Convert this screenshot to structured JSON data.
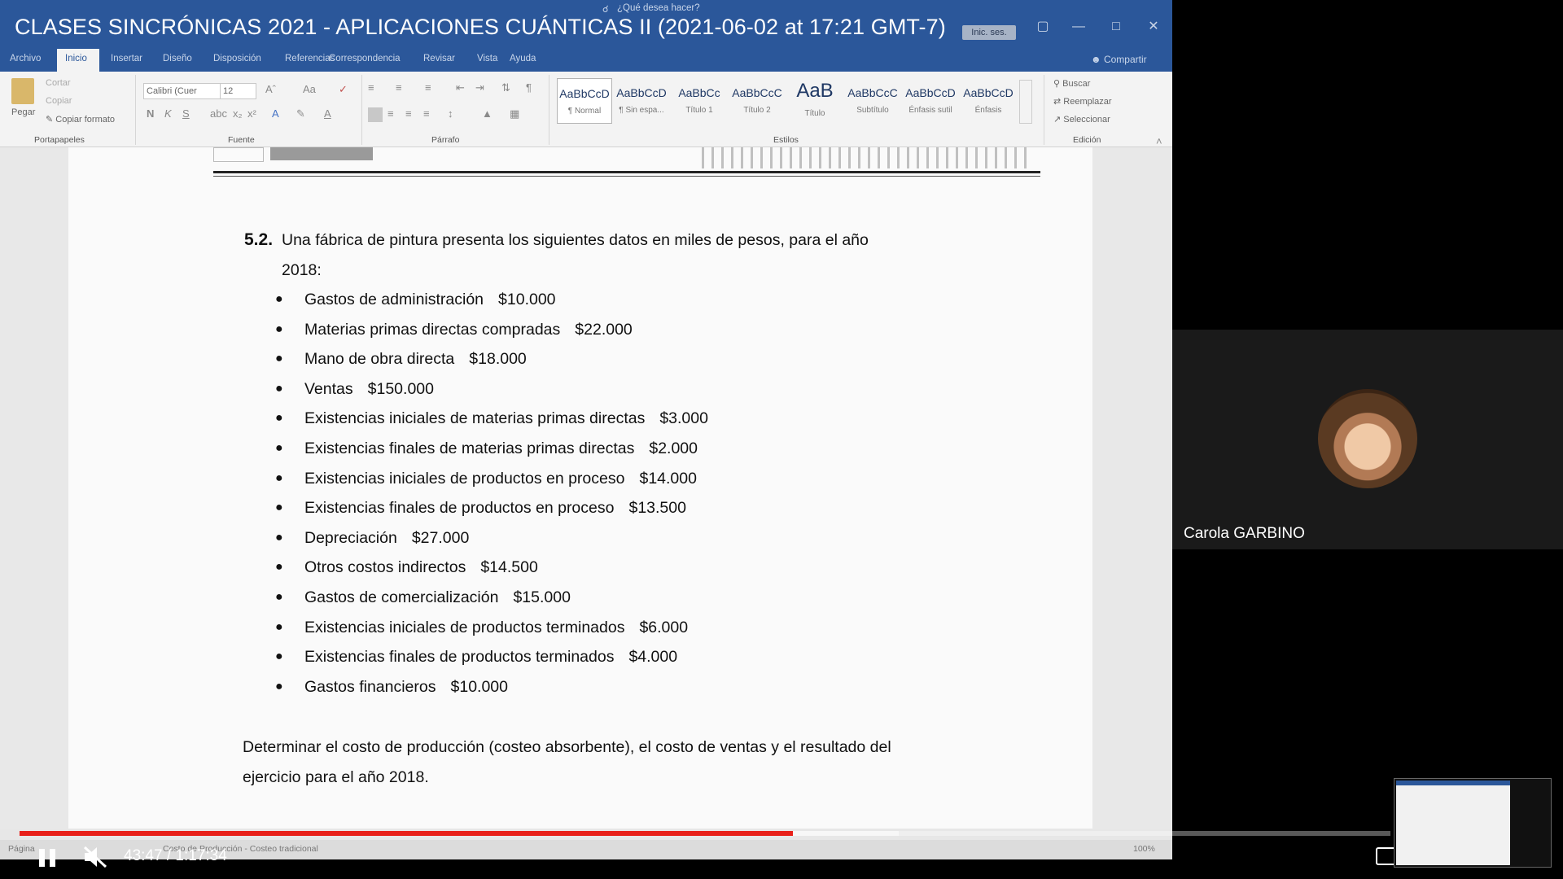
{
  "share_title": "CLASES SINCRÓNICAS 2021 - APLICACIONES CUÁNTICAS II (2021-06-02 at 17:21 GMT-7)",
  "word": {
    "signin": "Inic. ses.",
    "menu": [
      "Archivo",
      "Inicio",
      "Insertar",
      "Diseño",
      "Disposición",
      "Referencias",
      "Correspondencia",
      "Revisar",
      "Vista",
      "Ayuda"
    ],
    "tell_me": "¿Qué desea hacer?",
    "share": "Compartir",
    "clipboard": {
      "paste": "Pegar",
      "cut": "Cortar",
      "copy": "Copiar",
      "format_painter": "Copiar formato",
      "label": "Portapapeles"
    },
    "font": {
      "name": "Calibri (Cuer",
      "size": "12",
      "label": "Fuente"
    },
    "paragraph_label": "Párrafo",
    "styles": {
      "label": "Estilos",
      "items": [
        {
          "sample": "AaBbCcD",
          "name": "¶ Normal"
        },
        {
          "sample": "AaBbCcD",
          "name": "¶ Sin espa..."
        },
        {
          "sample": "AaBbCc",
          "name": "Título 1"
        },
        {
          "sample": "AaBbCcC",
          "name": "Título 2"
        },
        {
          "sample": "AaB",
          "name": "Título"
        },
        {
          "sample": "AaBbCcC",
          "name": "Subtítulo"
        },
        {
          "sample": "AaBbCcD",
          "name": "Énfasis sutil"
        },
        {
          "sample": "AaBbCcD",
          "name": "Énfasis"
        }
      ]
    },
    "editing": {
      "find": "Buscar",
      "replace": "Reemplazar",
      "select": "Seleccionar",
      "label": "Edición"
    },
    "status": {
      "page": "Página",
      "text": "Costo de Producción - Costeo tradicional",
      "zoom": "100%"
    }
  },
  "document": {
    "item_number": "5.2.",
    "prompt_line1": "Una fábrica de pintura presenta los siguientes datos en miles de pesos, para el año",
    "prompt_line2": "2018:",
    "items": [
      {
        "label": "Gastos de administración",
        "value": "$10.000"
      },
      {
        "label": "Materias primas directas compradas",
        "value": "$22.000"
      },
      {
        "label": "Mano de obra directa",
        "value": "$18.000"
      },
      {
        "label": "Ventas",
        "value": "$150.000"
      },
      {
        "label": "Existencias iniciales de materias primas directas",
        "value": "$3.000"
      },
      {
        "label": "Existencias finales de materias primas directas",
        "value": "$2.000"
      },
      {
        "label": "Existencias iniciales de productos en proceso",
        "value": "$14.000"
      },
      {
        "label": "Existencias finales de productos en proceso",
        "value": "$13.500"
      },
      {
        "label": "Depreciación",
        "value": "$27.000"
      },
      {
        "label": "Otros costos indirectos",
        "value": "$14.500"
      },
      {
        "label": "Gastos de comercialización",
        "value": "$15.000"
      },
      {
        "label": "Existencias iniciales de productos terminados",
        "value": "$6.000"
      },
      {
        "label": "Existencias finales de productos terminados",
        "value": "$4.000"
      },
      {
        "label": "Gastos financieros",
        "value": "$10.000"
      }
    ],
    "conclusion_line1": "Determinar el costo de producción (costeo absorbente), el costo de ventas y el resultado del",
    "conclusion_line2": "ejercicio para el año 2018."
  },
  "participant": {
    "name": "Carola GARBINO"
  },
  "player": {
    "time": "43:47 / 1:17:34",
    "progress_fraction": 0.564
  },
  "colors": {
    "word_blue": "#2b579a",
    "progress_red": "#e8201a"
  }
}
